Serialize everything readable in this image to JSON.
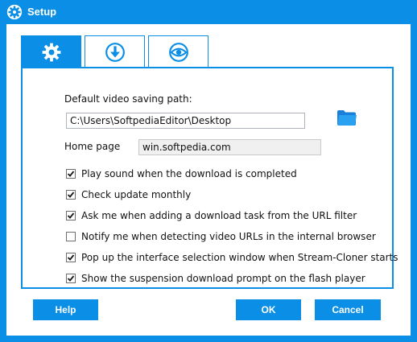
{
  "window": {
    "title": "Setup",
    "accent_color": "#0a8ee6"
  },
  "tabs": [
    {
      "icon": "gear-icon",
      "active": true
    },
    {
      "icon": "download-icon",
      "active": false
    },
    {
      "icon": "eye-icon",
      "active": false
    }
  ],
  "general": {
    "save_path_label": "Default video saving path:",
    "save_path_value": "C:\\Users\\SoftpediaEditor\\Desktop",
    "browse_icon": "folder-icon",
    "home_page_label": "Home page",
    "home_page_value": "win.softpedia.com"
  },
  "options": [
    {
      "label": "Play sound when the download is completed",
      "checked": true
    },
    {
      "label": "Check update monthly",
      "checked": true
    },
    {
      "label": "Ask me when adding a download task from the URL filter",
      "checked": true
    },
    {
      "label": "Notify me when detecting video URLs in the internal browser",
      "checked": false
    },
    {
      "label": "Pop up the interface selection window when Stream-Cloner starts",
      "checked": true
    },
    {
      "label": "Show the suspension download prompt on the flash player",
      "checked": true
    }
  ],
  "buttons": {
    "help": "Help",
    "ok": "OK",
    "cancel": "Cancel"
  }
}
